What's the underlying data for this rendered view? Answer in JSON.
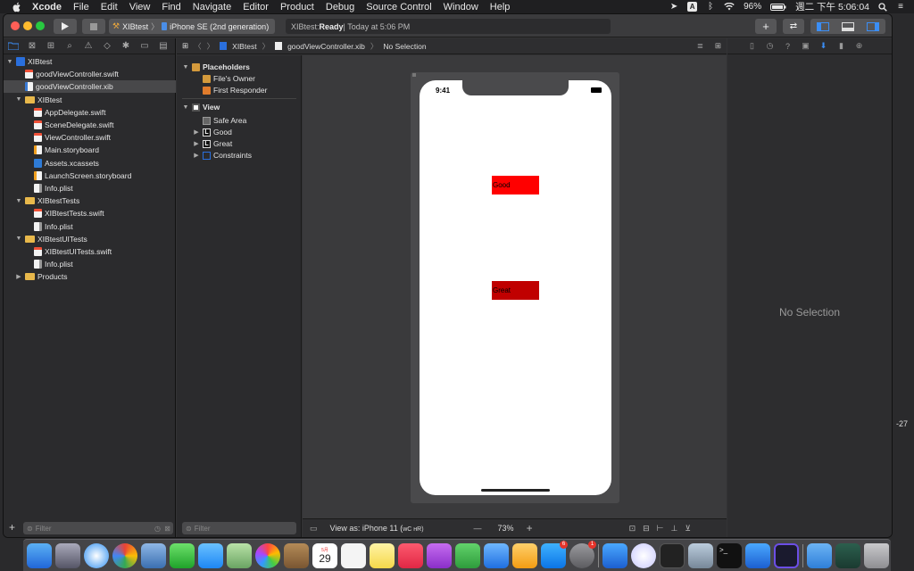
{
  "menubar": {
    "app": "Xcode",
    "items": [
      "File",
      "Edit",
      "View",
      "Find",
      "Navigate",
      "Editor",
      "Product",
      "Debug",
      "Source Control",
      "Window",
      "Help"
    ],
    "battery": "96%",
    "clock": "週二 下午 5:06:04",
    "input_source": "A"
  },
  "toolbar": {
    "scheme": "XIBtest",
    "destination": "iPhone SE (2nd generation)",
    "activity_project": "XIBtest: ",
    "activity_status": "Ready",
    "activity_time": " | Today at 5:06 PM"
  },
  "navigator": {
    "items": [
      {
        "label": "XIBtest",
        "type": "project",
        "level": 0,
        "expanded": true
      },
      {
        "label": "goodViewController.swift",
        "type": "swift",
        "level": 1
      },
      {
        "label": "goodViewController.xib",
        "type": "xib",
        "level": 1,
        "selected": true
      },
      {
        "label": "XIBtest",
        "type": "folder",
        "level": 1,
        "expanded": true
      },
      {
        "label": "AppDelegate.swift",
        "type": "swift",
        "level": 2
      },
      {
        "label": "SceneDelegate.swift",
        "type": "swift",
        "level": 2
      },
      {
        "label": "ViewController.swift",
        "type": "swift",
        "level": 2
      },
      {
        "label": "Main.storyboard",
        "type": "storyboard",
        "level": 2
      },
      {
        "label": "Assets.xcassets",
        "type": "assets",
        "level": 2
      },
      {
        "label": "LaunchScreen.storyboard",
        "type": "storyboard",
        "level": 2
      },
      {
        "label": "Info.plist",
        "type": "plist",
        "level": 2
      },
      {
        "label": "XIBtestTests",
        "type": "folder",
        "level": 1,
        "expanded": true
      },
      {
        "label": "XIBtestTests.swift",
        "type": "swift",
        "level": 2
      },
      {
        "label": "Info.plist",
        "type": "plist",
        "level": 2
      },
      {
        "label": "XIBtestUITests",
        "type": "folder",
        "level": 1,
        "expanded": true
      },
      {
        "label": "XIBtestUITests.swift",
        "type": "swift",
        "level": 2
      },
      {
        "label": "Info.plist",
        "type": "plist",
        "level": 2
      },
      {
        "label": "Products",
        "type": "folder",
        "level": 1,
        "expanded": false
      }
    ],
    "filter_placeholder": "Filter"
  },
  "jumpbar": {
    "project": "XIBtest",
    "file": "goodViewController.xib",
    "selection": "No Selection"
  },
  "outline": {
    "placeholders_header": "Placeholders",
    "files_owner": "File's Owner",
    "first_responder": "First Responder",
    "view": "View",
    "safe_area": "Safe Area",
    "good": "Good",
    "great": "Great",
    "constraints": "Constraints",
    "filter_placeholder": "Filter"
  },
  "device": {
    "time": "9:41",
    "label_good": "Good",
    "label_great": "Great",
    "good_color": "#ff0000",
    "great_color": "#c00000"
  },
  "canvas_bar": {
    "view_as": "View as: iPhone 11 (",
    "view_as_suffix": "ᴡC ʜR)",
    "zoom": "73%"
  },
  "inspector": {
    "no_selection": "No Selection"
  },
  "side_text": "-27",
  "dock": {
    "calendar_day": "29",
    "calendar_month": "5月",
    "appstore_badge": "6",
    "prefs_badge": "1"
  }
}
